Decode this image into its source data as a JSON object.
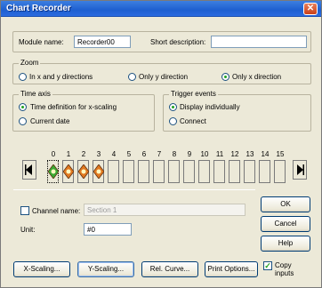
{
  "window": {
    "title": "Chart Recorder",
    "close_glyph": "✕"
  },
  "module": {
    "label": "Module name:",
    "value": "Recorder00"
  },
  "short_description": {
    "label": "Short description:",
    "value": ""
  },
  "zoom": {
    "title": "Zoom",
    "options": [
      {
        "label": "In x and y directions",
        "selected": false
      },
      {
        "label": "Only y direction",
        "selected": false
      },
      {
        "label": "Only x direction",
        "selected": true
      }
    ]
  },
  "time_axis": {
    "title": "Time axis",
    "options": [
      {
        "label": "Time definition for x-scaling",
        "selected": true
      },
      {
        "label": "Current date",
        "selected": false
      }
    ]
  },
  "trigger_events": {
    "title": "Trigger events",
    "options": [
      {
        "label": "Display individually",
        "selected": true
      },
      {
        "label": "Connect",
        "selected": false
      }
    ]
  },
  "channels": {
    "numbers": [
      "0",
      "1",
      "2",
      "3",
      "4",
      "5",
      "6",
      "7",
      "8",
      "9",
      "10",
      "11",
      "12",
      "13",
      "14",
      "15"
    ],
    "active_colors": [
      "#3aa832",
      "#e07820",
      "#e07820",
      "#e07820"
    ],
    "selected_index": 0
  },
  "channel_name": {
    "label": "Channel name:",
    "value": "Section 1",
    "checked": false
  },
  "unit": {
    "label": "Unit:",
    "value": "#0"
  },
  "buttons": {
    "ok": "OK",
    "cancel": "Cancel",
    "help": "Help",
    "x_scaling": "X-Scaling...",
    "y_scaling": "Y-Scaling...",
    "rel_curve": "Rel. Curve...",
    "print_options": "Print Options..."
  },
  "copy_inputs": {
    "label_line1": "Copy",
    "label_line2": "inputs",
    "checked": true
  },
  "icons": {
    "close": "close-icon",
    "left": "arrow-left-icon",
    "right": "arrow-right-icon"
  }
}
